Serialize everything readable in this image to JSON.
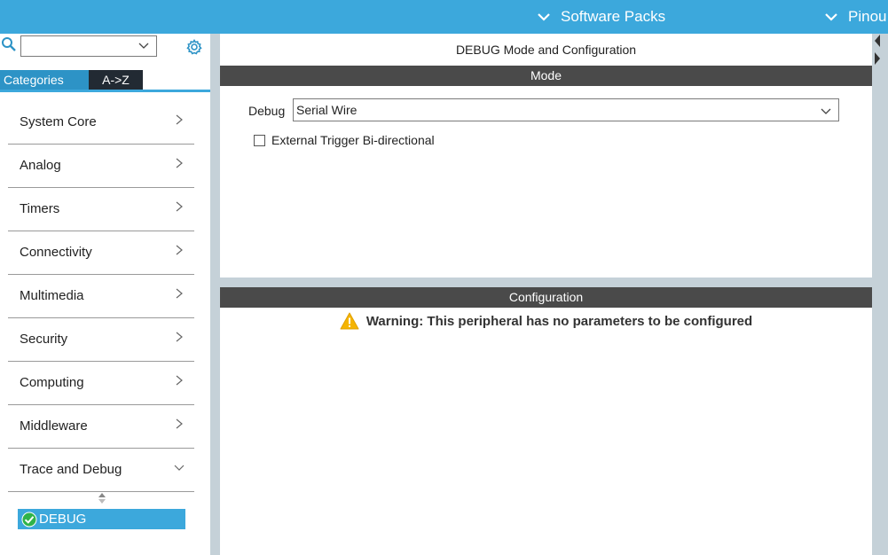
{
  "topbar": {
    "menus": [
      {
        "label": "Software Packs",
        "icon": "chevron-down-icon"
      },
      {
        "label": "Pinou",
        "icon": "chevron-down-icon"
      }
    ],
    "color": "#3ca8dc"
  },
  "left_panel": {
    "search": {
      "value": ""
    },
    "tabs": [
      {
        "label": "Categories",
        "active": true
      },
      {
        "label": "A->Z",
        "active": false
      }
    ],
    "categories": [
      {
        "label": "System Core",
        "expanded": false
      },
      {
        "label": "Analog",
        "expanded": false
      },
      {
        "label": "Timers",
        "expanded": false
      },
      {
        "label": "Connectivity",
        "expanded": false
      },
      {
        "label": "Multimedia",
        "expanded": false
      },
      {
        "label": "Security",
        "expanded": false
      },
      {
        "label": "Computing",
        "expanded": false
      },
      {
        "label": "Middleware",
        "expanded": false
      },
      {
        "label": "Trace and Debug",
        "expanded": true
      }
    ],
    "selected_item": {
      "label": "DEBUG",
      "status": "enabled"
    }
  },
  "main": {
    "title": "DEBUG Mode and Configuration",
    "mode": {
      "header": "Mode",
      "debug_label": "Debug",
      "debug_value": "Serial Wire",
      "checkbox_label": "External Trigger Bi-directional",
      "checkbox_checked": false
    },
    "configuration": {
      "header": "Configuration",
      "warning": "Warning: This peripheral has no parameters to be configured"
    }
  }
}
